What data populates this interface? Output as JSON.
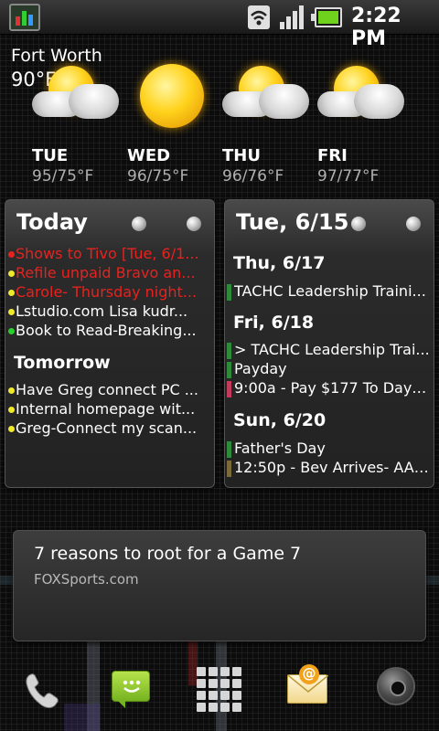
{
  "status_bar": {
    "time": "2:22 PM",
    "icons": [
      "notification-app-icon",
      "wifi-icon",
      "signal-icon",
      "battery-icon"
    ]
  },
  "weather": {
    "city": "Fort Worth",
    "current_temp": "90°F",
    "days": [
      {
        "day": "TUE",
        "range": "95/75°F",
        "icon": "partly-cloudy-icon"
      },
      {
        "day": "WED",
        "range": "96/75°F",
        "icon": "sunny-icon"
      },
      {
        "day": "THU",
        "range": "96/76°F",
        "icon": "partly-cloudy-icon"
      },
      {
        "day": "FRI",
        "range": "97/77°F",
        "icon": "partly-cloudy-icon"
      }
    ]
  },
  "tasks": {
    "title": "Today",
    "today": [
      {
        "text": "Shows to Tivo [Tue, 6/1...",
        "color": "#e8221e",
        "dot": "#e8221e"
      },
      {
        "text": "Refile unpaid Bravo an...",
        "color": "#e8221e",
        "dot": "#f0e82a"
      },
      {
        "text": "Carole- Thursday night...",
        "color": "#e8221e",
        "dot": "#f0e82a"
      },
      {
        "text": "Lstudio.com Lisa kudr...",
        "color": "#ffffff",
        "dot": "#f0e82a"
      },
      {
        "text": "Book to Read-Breaking...",
        "color": "#ffffff",
        "dot": "#27d12c"
      }
    ],
    "tomorrow_label": "Tomorrow",
    "tomorrow": [
      {
        "text": "Have Greg connect PC ...",
        "color": "#ffffff",
        "dot": "#f0e82a"
      },
      {
        "text": "Internal homepage wit...",
        "color": "#ffffff",
        "dot": "#f0e82a"
      },
      {
        "text": "Greg-Connect my scan...",
        "color": "#ffffff",
        "dot": "#f0e82a"
      }
    ]
  },
  "calendar": {
    "title": "Tue, 6/15",
    "groups": [
      {
        "date": "Thu, 6/17",
        "events": [
          {
            "text": "TACHC Leadership Traini...",
            "color": "#2e8b3a"
          }
        ]
      },
      {
        "date": "Fri, 6/18",
        "events": [
          {
            "text": "> TACHC Leadership Trai...",
            "color": "#2e8b3a"
          },
          {
            "text": "Payday",
            "color": "#2e8b3a"
          },
          {
            "text": "9:00a - Pay $177 To Dayc...",
            "color": "#c23a5c"
          }
        ]
      },
      {
        "date": "Sun, 6/20",
        "events": [
          {
            "text": "Father's Day",
            "color": "#2e8b3a"
          },
          {
            "text": "12:50p - Bev Arrives- AA ...",
            "color": "#7a6b3a"
          }
        ]
      }
    ]
  },
  "news": {
    "headline": "7 reasons to root for a Game 7",
    "source": "FOXSports.com"
  },
  "dock": {
    "items": [
      "phone-icon",
      "messaging-icon",
      "app-drawer-icon",
      "email-icon",
      "camera-icon"
    ]
  }
}
